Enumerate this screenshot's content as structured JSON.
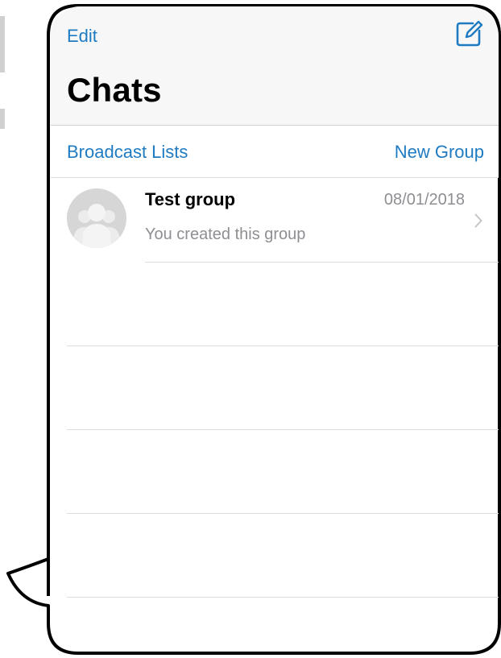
{
  "header": {
    "edit_label": "Edit",
    "compose_icon": "compose-icon",
    "title": "Chats"
  },
  "links": {
    "broadcast_lists": "Broadcast Lists",
    "new_group": "New Group"
  },
  "chats": [
    {
      "name": "Test group",
      "date": "08/01/2018",
      "preview": "You created this group",
      "avatar_icon": "group-avatar-icon"
    }
  ],
  "colors": {
    "accent": "#1f7bc1",
    "secondary_text": "#8e8e93",
    "header_bg": "#f7f7f7"
  }
}
